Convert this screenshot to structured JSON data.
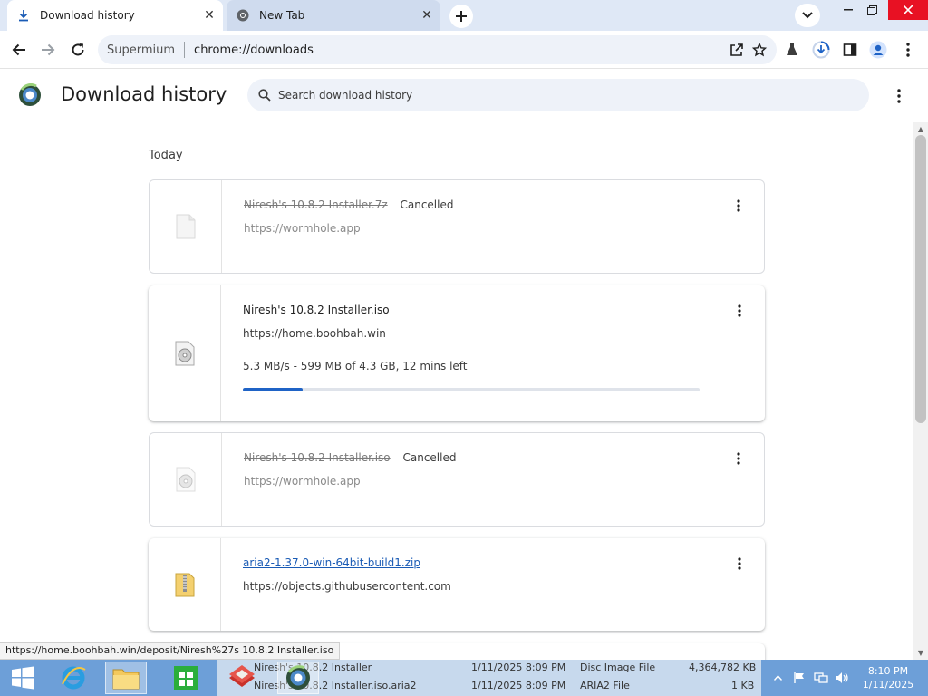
{
  "browser": {
    "tabs": [
      {
        "title": "Download history",
        "icon": "download-icon",
        "active": true
      },
      {
        "title": "New Tab",
        "icon": "chromium-icon",
        "active": false
      }
    ],
    "omnibox": {
      "site_name": "Supermium",
      "url": "chrome://downloads"
    }
  },
  "page": {
    "title": "Download history",
    "search_placeholder": "Search download history"
  },
  "downloads": {
    "date_heading": "Today",
    "items": [
      {
        "file": "Niresh's 10.8.2 Installer.7z",
        "status": "Cancelled",
        "url": "https://wormhole.app",
        "icon": "generic-file-icon"
      },
      {
        "file": "Niresh's 10.8.2 Installer.iso",
        "status": "",
        "url": "https://home.boohbah.win",
        "progress_text": "5.3 MB/s - 599 MB of 4.3 GB, 12 mins left",
        "progress_fraction": 0.13,
        "icon": "disc-image-icon"
      },
      {
        "file": "Niresh's 10.8.2 Installer.iso",
        "status": "Cancelled",
        "url": "https://wormhole.app",
        "icon": "disc-image-icon"
      },
      {
        "file": "aria2-1.37.0-win-64bit-build1.zip",
        "status": "",
        "url": "https://objects.githubusercontent.com",
        "icon": "zip-folder-icon"
      }
    ]
  },
  "status_bar": {
    "hover_url": "https://home.boohbah.win/deposit/Niresh%27s 10.8.2 Installer.iso"
  },
  "taskbar": {
    "background_rows": [
      {
        "name": "Niresh's 10.8.2 Installer",
        "date": "1/11/2025 8:09 PM",
        "type": "Disc Image File",
        "size": "4,364,782 KB"
      },
      {
        "name": "Niresh's 10.8.2 Installer.iso.aria2",
        "date": "1/11/2025 8:09 PM",
        "type": "ARIA2 File",
        "size": "1 KB"
      }
    ],
    "clock": {
      "time": "8:10 PM",
      "date": "1/11/2025"
    }
  },
  "colors": {
    "accent": "#1f63c6",
    "link": "#1a5bb5",
    "taskbar": "#6d9fd8",
    "close": "#e81123"
  }
}
